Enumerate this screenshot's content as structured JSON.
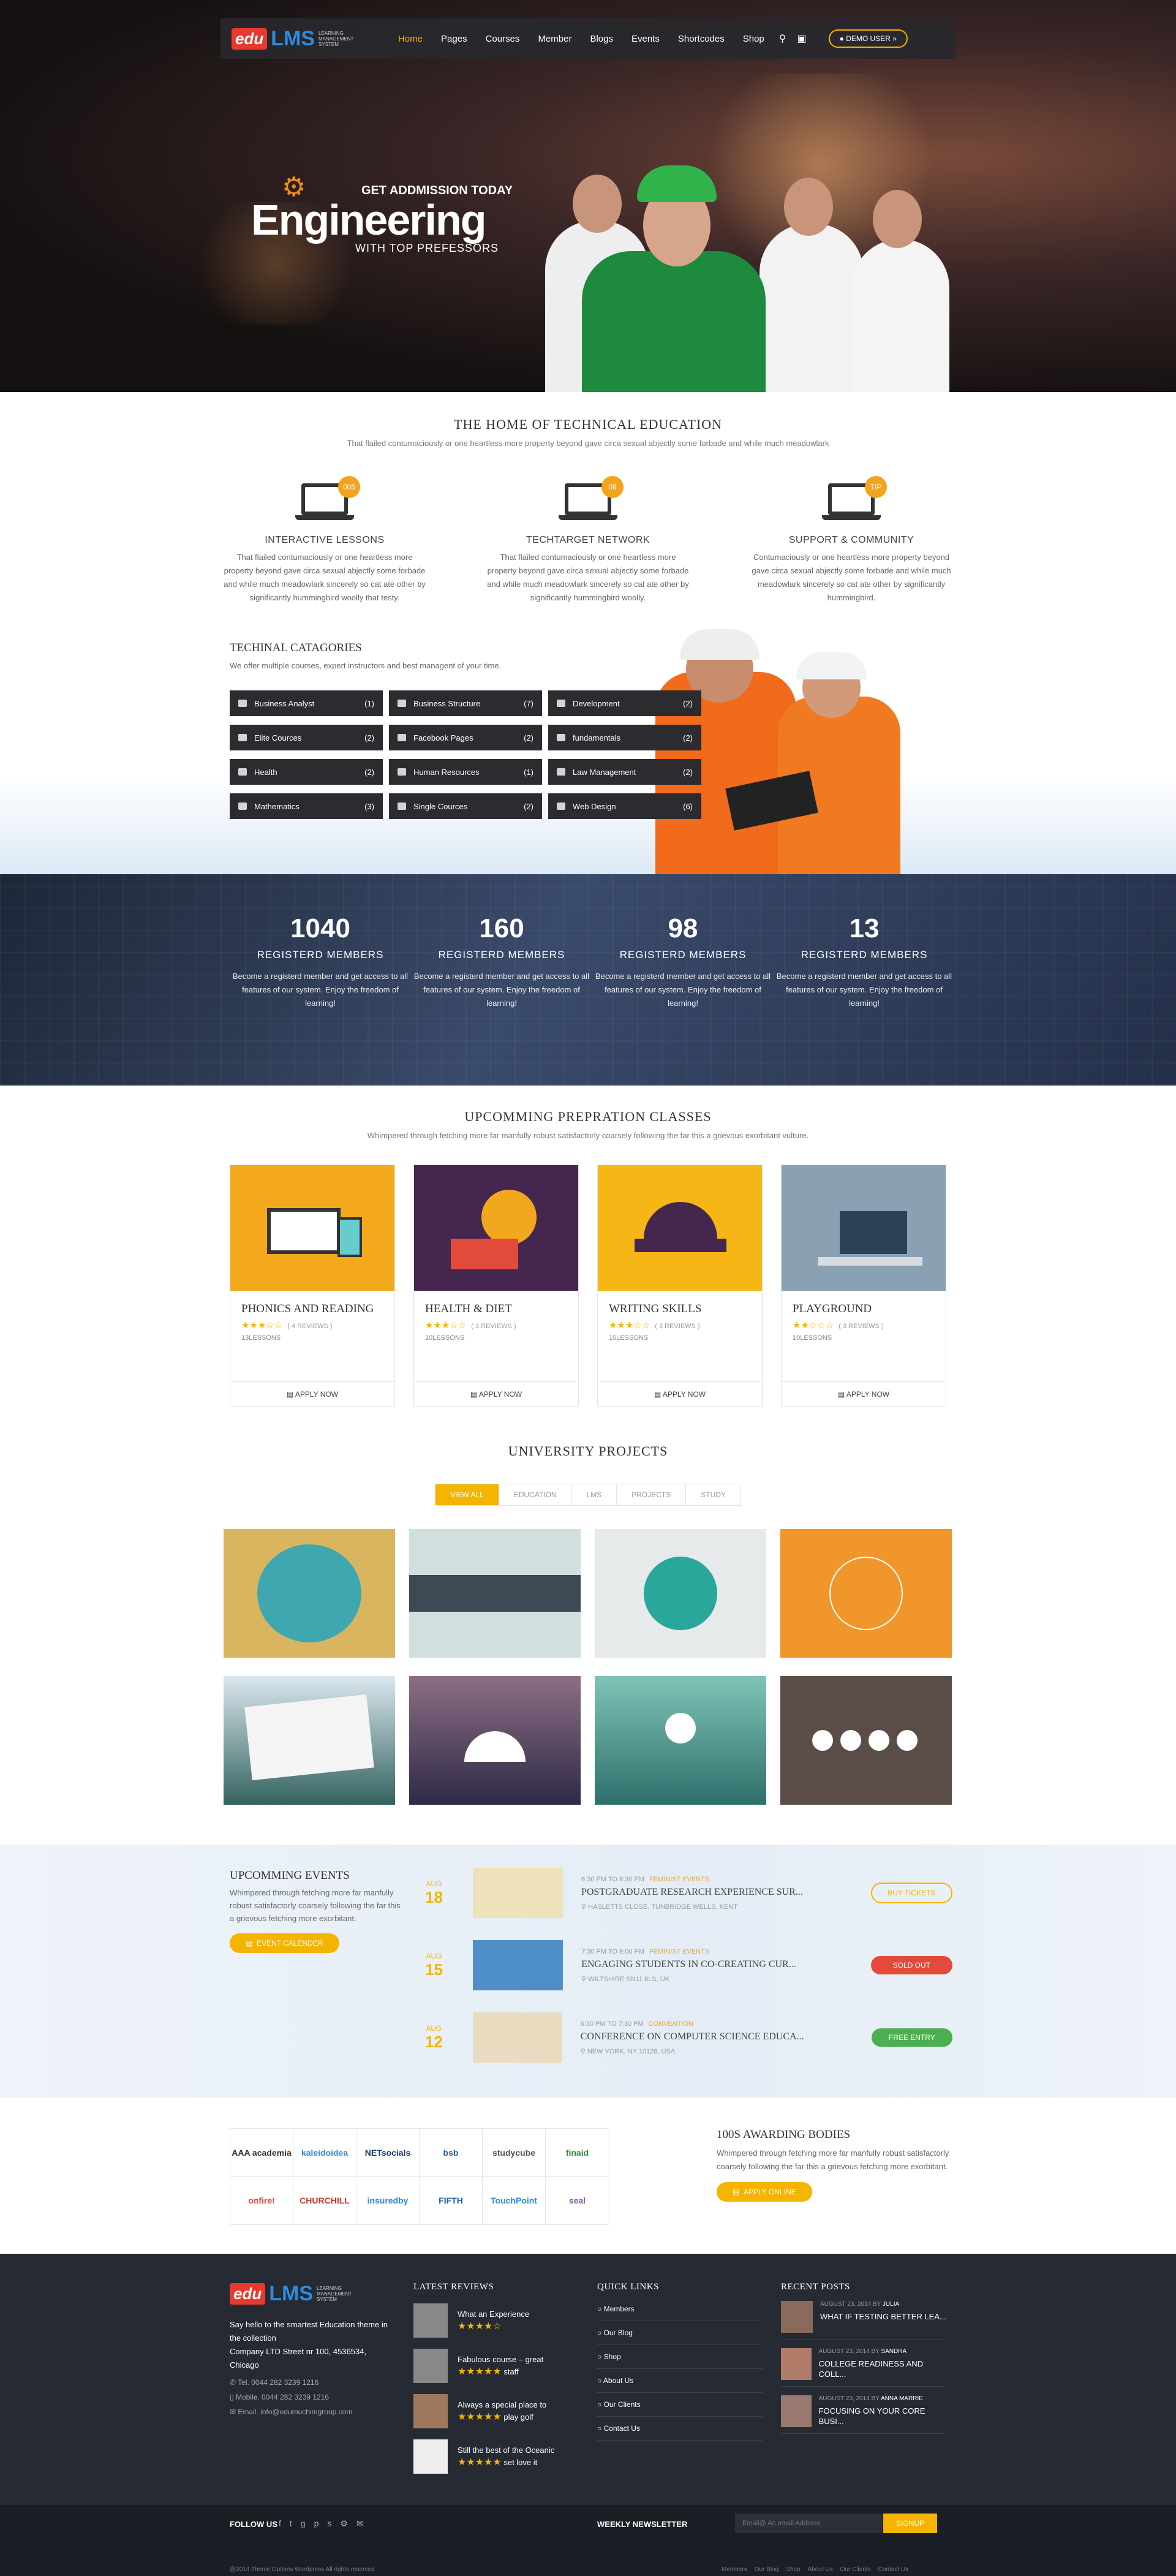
{
  "nav": {
    "logo_edu": "edu",
    "logo_lms": "LMS",
    "logo_sub": "LEARNING MANAGEMENT SYSTEM",
    "items": [
      "Home",
      "Pages",
      "Courses",
      "Member",
      "Blogs",
      "Events",
      "Shortcodes",
      "Shop"
    ],
    "demo": "DEMO USER"
  },
  "hero": {
    "line1": "GET ADDMISSION TODAY",
    "line2": "Engineering",
    "line3": "WITH TOP PREFESSORS"
  },
  "home": {
    "title": "THE HOME OF TECHNICAL EDUCATION",
    "lead": "That flailed contumaciously or one heartless more property beyond gave circa sexual abjectly some forbade and while much meadowlark",
    "features": [
      {
        "badge": "005",
        "title": "INTERACTIVE LESSONS",
        "text": "That flailed contumaciously or one heartless more property beyond gave circa sexual abjectly some forbade and while much meadowlark sincerely so cat ate other by significantly hummingbird woolly that testy."
      },
      {
        "badge": "08",
        "title": "TECHTARGET NETWORK",
        "text": "That flailed contumaciously or one heartless more property beyond gave circa sexual abjectly some forbade and while much meadowlark sincerely so cat ate other by significantly hummingbird woolly."
      },
      {
        "badge": "TIP",
        "title": "SUPPORT & COMMUNITY",
        "text": "Contumaciously or one heartless more property beyond gave circa sexual abjectly some forbade and while much meadowlark sincerely so cat ate other by significantly hummingbird."
      }
    ]
  },
  "categories": {
    "title": "TECHINAL CATAGORIES",
    "desc": "We offer multiple courses, expert instructors and best managent of your time.",
    "items": [
      {
        "name": "Business Analyst",
        "count": "(1)"
      },
      {
        "name": "Business Structure",
        "count": "(7)"
      },
      {
        "name": "Development",
        "count": "(2)"
      },
      {
        "name": "Elite Cources",
        "count": "(2)"
      },
      {
        "name": "Facebook Pages",
        "count": "(2)"
      },
      {
        "name": "fundamentals",
        "count": "(2)"
      },
      {
        "name": "Health",
        "count": "(2)"
      },
      {
        "name": "Human Resources",
        "count": "(1)"
      },
      {
        "name": "Law Management",
        "count": "(2)"
      },
      {
        "name": "Mathematics",
        "count": "(3)"
      },
      {
        "name": "Single Cources",
        "count": "(2)"
      },
      {
        "name": "Web Design",
        "count": "(6)"
      }
    ]
  },
  "stats": [
    {
      "number": "1040",
      "label": "REGISTERD MEMBERS",
      "text": "Become a registerd member and get access to all features of our system. Enjoy the freedom of learning!"
    },
    {
      "number": "160",
      "label": "REGISTERD MEMBERS",
      "text": "Become a registerd member and get access to all features of our system. Enjoy the freedom of learning!"
    },
    {
      "number": "98",
      "label": "REGISTERD MEMBERS",
      "text": "Become a registerd member and get access to all features of our system. Enjoy the freedom of learning!"
    },
    {
      "number": "13",
      "label": "REGISTERD MEMBERS",
      "text": "Become a registerd member and get access to all features of our system. Enjoy the freedom of learning!"
    }
  ],
  "classes": {
    "title": "UPCOMMING PREPRATION CLASSES",
    "lead": "Whimpered through fetching more far manfully robust satisfactorly coarsely following the far this a grievous exorbitant vulture.",
    "cards": [
      {
        "title": "PHONICS AND READING",
        "stars": "★★★☆☆",
        "reviews": "( 4 REVIEWS )",
        "lessons": "13LESSONS",
        "apply": "APPLY NOW",
        "bg": "#f4a81c"
      },
      {
        "title": "HEALTH & DIET",
        "stars": "★★★☆☆",
        "reviews": "( 3 REVIEWS )",
        "lessons": "10LESSONS",
        "apply": "APPLY NOW",
        "bg": "#45264f"
      },
      {
        "title": "WRITING SKILLS",
        "stars": "★★★☆☆",
        "reviews": "( 3 REVIEWS )",
        "lessons": "10LESSONS",
        "apply": "APPLY NOW",
        "bg": "#f6b716"
      },
      {
        "title": "PLAYGROUND",
        "stars": "★★☆☆☆",
        "reviews": "( 3 REVIEWS )",
        "lessons": "10LESSONS",
        "apply": "APPLY NOW",
        "bg": "#8aa1b3"
      }
    ]
  },
  "projects": {
    "title": "UNIVERSITY PROJECTS",
    "filters": [
      "VIEW ALL",
      "EDUCATION",
      "LMS",
      "PROJECTS",
      "STUDY"
    ]
  },
  "events": {
    "title": "UPCOMMING EVENTS",
    "text": "Whimpered through fetching more far manfully robust satisfactorly coarsely following the far this a grievous fetching more exorbitant.",
    "button": "EVENT CALENDER",
    "items": [
      {
        "month": "AUG",
        "day": "18",
        "time": "6:30 PM TO 8:30 PM",
        "tag": "FEMINIST EVENTS",
        "title": "POSTGRADUATE RESEARCH EXPERIENCE SUR...",
        "loc": "HASLETTS CLOSE, TUNBRIDGE WELLS, KENT",
        "action": "BUY TICKETS"
      },
      {
        "month": "AUG",
        "day": "15",
        "time": "7:30 PM TO 9:00 PM",
        "tag": "FEMINIST EVENTS",
        "title": "ENGAGING STUDENTS IN CO-CREATING CUR...",
        "loc": "WILTSHIRE SN11 8LS, UK",
        "action": "SOLD OUT"
      },
      {
        "month": "AUG",
        "day": "12",
        "time": "6:30 PM TO 7:30 PM",
        "tag": "CONVENTION",
        "title": "CONFERENCE ON COMPUTER SCIENCE EDUCA...",
        "loc": "NEW YORK, NY 10128, USA",
        "action": "FREE ENTRY"
      }
    ]
  },
  "awards": {
    "title": "100S AWARDING BODIES",
    "text": "Whimpered through fetching more far manfully robust satisfactorly coarsely following the far this a grievous fetching more exorbitant.",
    "button": "APPLY ONLINE",
    "logos": [
      "AAA academia",
      "kaleidoidea",
      "NETsocials",
      "bsb",
      "studycube",
      "finaid",
      "onfire!",
      "CHURCHILL",
      "insuredby",
      "FIFTH",
      "TouchPoint",
      "seal"
    ]
  },
  "footer": {
    "about": "Say hello to the smartest Education theme in the collection",
    "address": "Company LTD Street nr 100, 4536534, Chicago",
    "tel": "Tel. 0044 282 3239 1216",
    "mobile": "Mobile. 0044 282 3239 1216",
    "email": "Email. info@edumuchimgroup.com",
    "reviews_title": "LATEST REVIEWS",
    "reviews": [
      {
        "a": "What an Experience",
        "b": ""
      },
      {
        "a": "Fabulous course – great",
        "b": "staff"
      },
      {
        "a": "Always a special place to",
        "b": "play golf"
      },
      {
        "a": "Still the best of the Oceanic",
        "b": "set love it"
      }
    ],
    "links_title": "QUICK LINKS",
    "links": [
      "Members",
      "Our Blog",
      "Shop",
      "About Us",
      "Our Clients",
      "Contact Us"
    ],
    "posts_title": "RECENT POSTS",
    "posts": [
      {
        "date": "AUGUST 23, 2014",
        "by": "JULIA",
        "title": "WHAT IF TESTING BETTER LEA..."
      },
      {
        "date": "AUGUST 23, 2014",
        "by": "SANDRA",
        "title": "COLLEGE READINESS AND COLL..."
      },
      {
        "date": "AUGUST 23, 2014",
        "by": "ANNA MARRIE",
        "title": "FOCUSING ON YOUR CORE BUSI..."
      }
    ],
    "follow": "FOLLOW US",
    "newsletter": "WEEKLY NEWSLETTER",
    "email_placeholder": "Email@ An email Address",
    "signup": "SIGNUP",
    "copyright": "@2014 Theme Options Wordpress All rights reserved",
    "bottom_links": [
      "Members",
      "Our Blog",
      "Shop",
      "About Us",
      "Our Clients",
      "Contact Us"
    ]
  }
}
